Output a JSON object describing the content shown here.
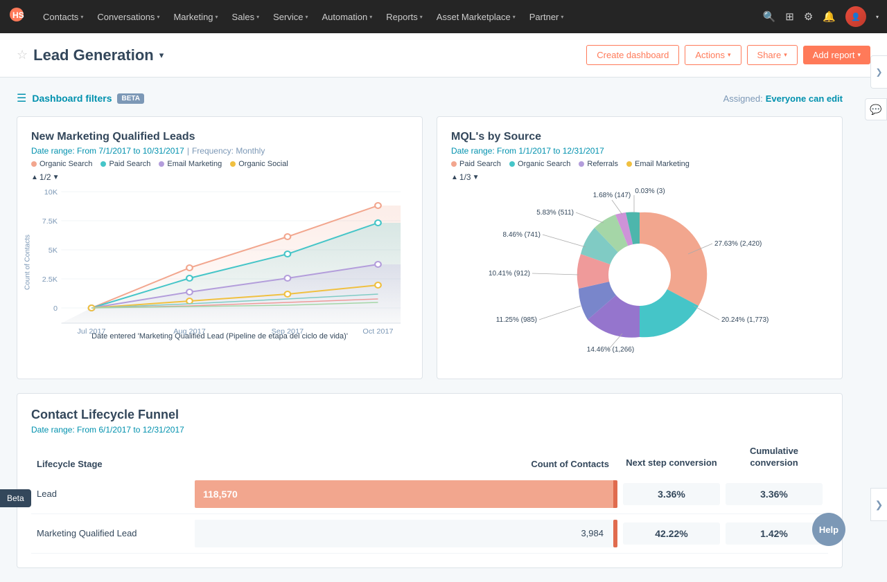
{
  "nav": {
    "logo": "🟠",
    "items": [
      {
        "label": "Contacts",
        "caret": true
      },
      {
        "label": "Conversations",
        "caret": true
      },
      {
        "label": "Marketing",
        "caret": true
      },
      {
        "label": "Sales",
        "caret": true
      },
      {
        "label": "Service",
        "caret": true
      },
      {
        "label": "Automation",
        "caret": true
      },
      {
        "label": "Reports",
        "caret": true
      },
      {
        "label": "Asset Marketplace",
        "caret": true
      },
      {
        "label": "Partner",
        "caret": true
      }
    ]
  },
  "header": {
    "title": "Lead Generation",
    "create_dashboard": "Create dashboard",
    "actions": "Actions",
    "share": "Share",
    "add_report": "Add report"
  },
  "filters": {
    "label": "Dashboard filters",
    "beta": "BETA",
    "assigned_prefix": "Assigned:",
    "assigned_link": "Everyone can edit"
  },
  "chart1": {
    "title": "New Marketing Qualified Leads",
    "date_range": "Date range: From 7/1/2017 to 10/31/2017",
    "frequency": "Frequency: Monthly",
    "pagination": "1/2",
    "y_label": "Count of Contacts",
    "x_label": "Date entered 'Marketing Qualified Lead (Pipeline de etapa del ciclo de vida)'",
    "x_ticks": [
      "Jul 2017",
      "Aug 2017",
      "Sep 2017",
      "Oct 2017"
    ],
    "y_ticks": [
      "0",
      "2.5K",
      "5K",
      "7.5K",
      "10K"
    ],
    "legend": [
      {
        "label": "Organic Search",
        "color": "#f2a68e"
      },
      {
        "label": "Paid Search",
        "color": "#45c5c8"
      },
      {
        "label": "Email Marketing",
        "color": "#b39ddb"
      },
      {
        "label": "Organic Social",
        "color": "#f0c040"
      }
    ]
  },
  "chart2": {
    "title": "MQL's by Source",
    "date_range": "Date range: From 1/1/2017 to 12/31/2017",
    "pagination": "1/3",
    "legend": [
      {
        "label": "Paid Search",
        "color": "#f2a68e"
      },
      {
        "label": "Organic Search",
        "color": "#45c5c8"
      },
      {
        "label": "Referrals",
        "color": "#b39ddb"
      },
      {
        "label": "Email Marketing",
        "color": "#f0c040"
      }
    ],
    "segments": [
      {
        "label": "27.63% (2,420)",
        "value": 27.63,
        "color": "#f2a68e",
        "position": "right"
      },
      {
        "label": "20.24% (1,773)",
        "value": 20.24,
        "color": "#45c5c8",
        "position": "bottom-right"
      },
      {
        "label": "14.46% (1,266)",
        "value": 14.46,
        "color": "#9575cd",
        "position": "bottom"
      },
      {
        "label": "11.25% (985)",
        "value": 11.25,
        "color": "#7986cb",
        "position": "bottom-left"
      },
      {
        "label": "10.41% (912)",
        "value": 10.41,
        "color": "#ef9a9a",
        "position": "left"
      },
      {
        "label": "8.46% (741)",
        "value": 8.46,
        "color": "#80cbc4",
        "position": "left"
      },
      {
        "label": "5.83% (511)",
        "value": 5.83,
        "color": "#a5d6a7",
        "position": "top-left"
      },
      {
        "label": "1.68% (147)",
        "value": 1.68,
        "color": "#ce93d8",
        "position": "top"
      },
      {
        "label": "0.03% (3)",
        "value": 0.03,
        "color": "#4db6ac",
        "position": "top"
      }
    ]
  },
  "funnel": {
    "title": "Contact Lifecycle Funnel",
    "date_range": "Date range: From 6/1/2017 to 12/31/2017",
    "col_stage": "Lifecycle Stage",
    "col_count": "Count of Contacts",
    "col_next": "Next step conversion",
    "col_cumulative": "Cumulative conversion",
    "rows": [
      {
        "stage": "Lead",
        "count": 118570,
        "count_display": "118,570",
        "next_conversion": "3.36%",
        "cumulative": "3.36%",
        "bar_color": "#f2a68e",
        "bar_width_pct": 100,
        "accent_color": "#e8856a"
      },
      {
        "stage": "Marketing Qualified Lead",
        "count": 3984,
        "count_display": "3,984",
        "next_conversion": "42.22%",
        "cumulative": "1.42%",
        "bar_color": "#f2a68e",
        "bar_width_pct": 4,
        "accent_color": "#e8856a"
      }
    ]
  },
  "ui": {
    "beta_tab": "Beta",
    "help_btn": "Help",
    "sidebar_collapse": "❯",
    "chat_icon": "💬"
  }
}
